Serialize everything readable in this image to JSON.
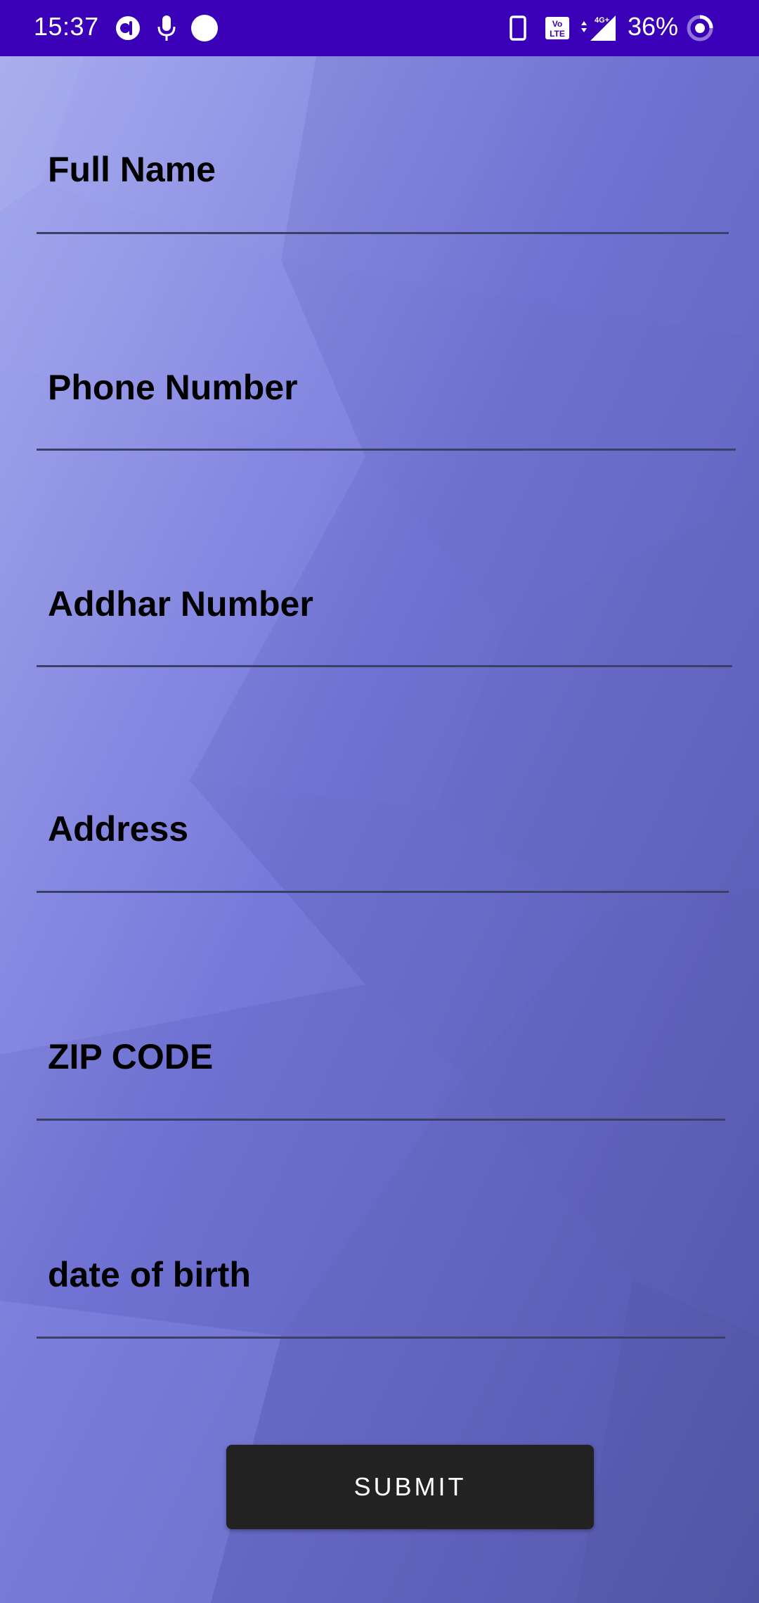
{
  "status_bar": {
    "time": "15:37",
    "battery_percent": "36%",
    "icons": [
      "assistant-icon",
      "microphone-icon",
      "circle-dot-icon",
      "phone-vibrate-icon",
      "volte-icon",
      "signal-4g-icon",
      "battery-ring-icon"
    ]
  },
  "form": {
    "fields": [
      {
        "placeholder": "Full Name"
      },
      {
        "placeholder": "Phone Number"
      },
      {
        "placeholder": "Addhar Number"
      },
      {
        "placeholder": "Address"
      },
      {
        "placeholder": "ZIP CODE"
      },
      {
        "placeholder": "date of birth"
      }
    ],
    "submit_label": "SUBMIT"
  },
  "colors": {
    "status_bar": "#3a00b8",
    "background": "#6f72d6",
    "button": "#222222",
    "underline": "#3c3f66"
  }
}
